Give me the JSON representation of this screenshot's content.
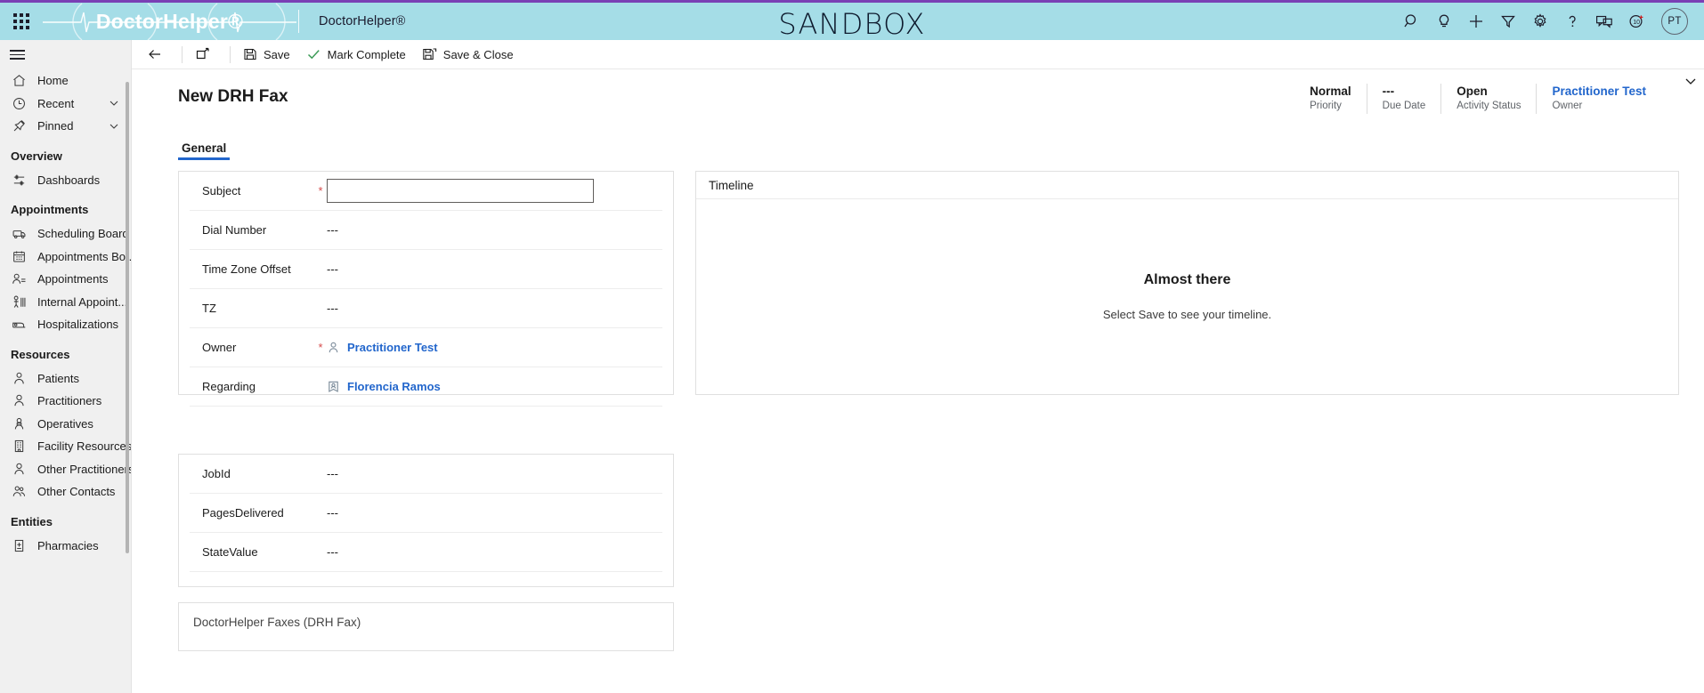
{
  "topbar": {
    "waffle_icon": "app-launcher-waffle-icon",
    "logo_text": "DoctorHelper®",
    "app_name": "DoctorHelper®",
    "environment_banner": "SANDBOX",
    "brand_bg": "#a5dde7",
    "brand_accent": "#7a3fb5",
    "icons": [
      {
        "name": "search-icon",
        "glyph": "search"
      },
      {
        "name": "lightbulb-icon",
        "glyph": "bulb"
      },
      {
        "name": "quick-create-icon",
        "glyph": "plus"
      },
      {
        "name": "filter-icon",
        "glyph": "filter"
      },
      {
        "name": "settings-gear-icon",
        "glyph": "gear"
      },
      {
        "name": "help-icon",
        "glyph": "question"
      },
      {
        "name": "feedback-icon",
        "glyph": "chat"
      },
      {
        "name": "assistant-icon",
        "glyph": "assistant"
      }
    ],
    "avatar_initials": "PT"
  },
  "commandbar": {
    "back_label": "Back",
    "popout_label": "Open in new window",
    "save_label": "Save",
    "mark_complete_label": "Mark Complete",
    "save_close_label": "Save & Close"
  },
  "header": {
    "title": "New DRH Fax",
    "stats": [
      {
        "value": "Normal",
        "label": "Priority",
        "link": false
      },
      {
        "value": "---",
        "label": "Due Date",
        "link": false
      },
      {
        "value": "Open",
        "label": "Activity Status",
        "link": false
      },
      {
        "value": "Practitioner Test",
        "label": "Owner",
        "link": true
      }
    ],
    "chevron_icon": "chevron-down-icon"
  },
  "tabs": [
    {
      "label": "General",
      "active": true
    }
  ],
  "form": {
    "main_fields": [
      {
        "label": "Subject",
        "required": true,
        "type": "input",
        "value": "",
        "placeholder": ""
      },
      {
        "label": "Dial Number",
        "required": false,
        "type": "text",
        "value": "---"
      },
      {
        "label": "Time Zone Offset",
        "required": false,
        "type": "text",
        "value": "---"
      },
      {
        "label": "TZ",
        "required": false,
        "type": "text",
        "value": "---"
      },
      {
        "label": "Owner",
        "required": true,
        "type": "lookup",
        "value": "Practitioner Test",
        "icon": "user-icon"
      },
      {
        "label": "Regarding",
        "required": false,
        "type": "lookup",
        "value": "Florencia Ramos",
        "icon": "contact-card-icon"
      }
    ],
    "second_fields": [
      {
        "label": "JobId",
        "required": false,
        "type": "text",
        "value": "---"
      },
      {
        "label": "PagesDelivered",
        "required": false,
        "type": "text",
        "value": "---"
      },
      {
        "label": "StateValue",
        "required": false,
        "type": "text",
        "value": "---"
      }
    ],
    "third_section_title": "DoctorHelper Faxes (DRH Fax)"
  },
  "timeline": {
    "header": "Timeline",
    "empty_title": "Almost there",
    "empty_subtitle": "Select Save to see your timeline."
  },
  "sidebar": {
    "hamburger_icon": "hamburger-menu-icon",
    "items": [
      {
        "label": "Home",
        "icon": "home-icon",
        "type": "item"
      },
      {
        "label": "Recent",
        "icon": "clock-icon",
        "type": "item",
        "chevron": true
      },
      {
        "label": "Pinned",
        "icon": "pin-icon",
        "type": "item",
        "chevron": true
      },
      {
        "label": "Overview",
        "type": "group"
      },
      {
        "label": "Dashboards",
        "icon": "dashboard-icon",
        "type": "item"
      },
      {
        "label": "Appointments",
        "type": "group"
      },
      {
        "label": "Scheduling Board",
        "icon": "scheduling-board-icon",
        "type": "item"
      },
      {
        "label": "Appointments Bo...",
        "icon": "calendar-icon",
        "type": "item"
      },
      {
        "label": "Appointments",
        "icon": "appointment-icon",
        "type": "item"
      },
      {
        "label": "Internal Appoint...",
        "icon": "internal-appointment-icon",
        "type": "item"
      },
      {
        "label": "Hospitalizations",
        "icon": "bed-icon",
        "type": "item"
      },
      {
        "label": "Resources",
        "type": "group"
      },
      {
        "label": "Patients",
        "icon": "patient-icon",
        "type": "item"
      },
      {
        "label": "Practitioners",
        "icon": "practitioner-icon",
        "type": "item"
      },
      {
        "label": "Operatives",
        "icon": "operative-icon",
        "type": "item"
      },
      {
        "label": "Facility Resources",
        "icon": "building-icon",
        "type": "item"
      },
      {
        "label": "Other Practitioners",
        "icon": "practitioner-icon",
        "type": "item"
      },
      {
        "label": "Other Contacts",
        "icon": "contacts-icon",
        "type": "item"
      },
      {
        "label": "Entities",
        "type": "group"
      },
      {
        "label": "Pharmacies",
        "icon": "pharmacy-icon",
        "type": "item"
      }
    ]
  }
}
